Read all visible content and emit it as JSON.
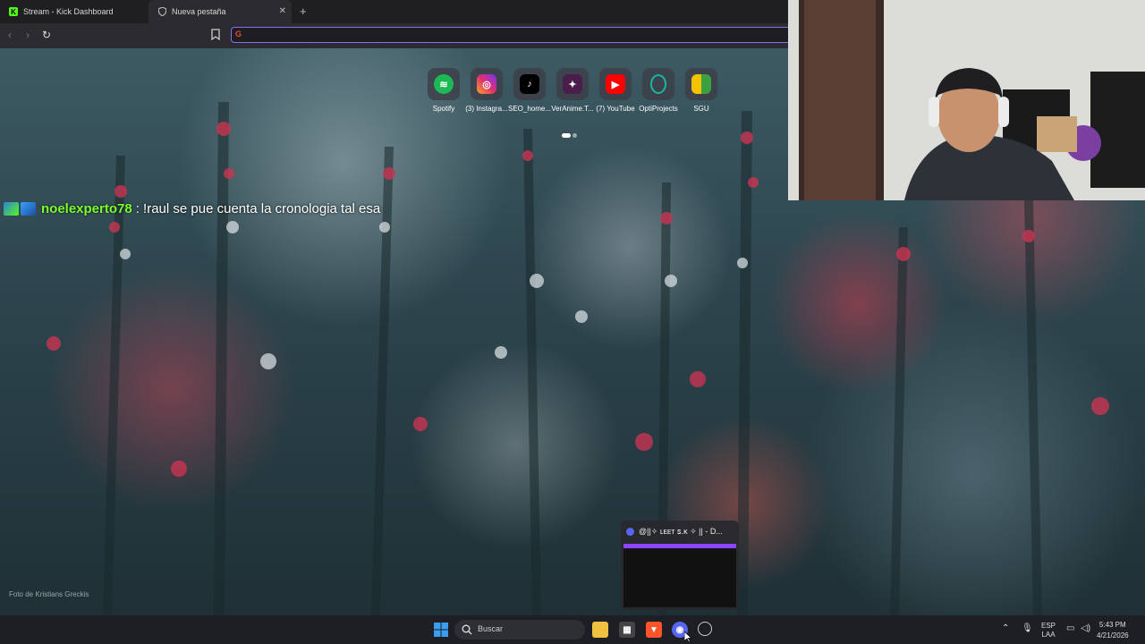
{
  "browser": {
    "tabs": [
      {
        "title": "Stream - Kick Dashboard",
        "icon": "kick-icon"
      },
      {
        "title": "Nueva pestaña",
        "icon": "shield-icon",
        "active": true
      }
    ],
    "address_bar": {
      "value": "",
      "placeholder": ""
    }
  },
  "shortcuts": [
    {
      "label": "Spotify",
      "icon": "spotify-icon",
      "color": "#1db954"
    },
    {
      "label": "(3) Instagra...",
      "icon": "instagram-icon",
      "color": "#e1306c"
    },
    {
      "label": "SEO_home...",
      "icon": "tiktok-icon",
      "color": "#000000"
    },
    {
      "label": "VerAnime.T...",
      "icon": "veranime-icon",
      "color": "#4a1d4a"
    },
    {
      "label": "(7) YouTube",
      "icon": "youtube-icon",
      "color": "#ff0000"
    },
    {
      "label": "OptiProjects",
      "icon": "optiprojects-icon",
      "color": "#19b6a0"
    },
    {
      "label": "SGU",
      "icon": "sgu-icon",
      "color": "#f2c200"
    }
  ],
  "chat": {
    "username": "noelexperto78",
    "message": ": !raul se pue cuenta la cronologia tal esa"
  },
  "photo_credit": "Foto de Kristians Greckis",
  "discord_preview": {
    "title": "@||✧ ʟᴇᴇᴛ ꜱ.ᴋ ✧ || - D..."
  },
  "taskbar": {
    "search_placeholder": "Buscar",
    "language": "ESP",
    "layout": "LAA",
    "time": "5:43 PM",
    "date": "4/21/2026"
  }
}
